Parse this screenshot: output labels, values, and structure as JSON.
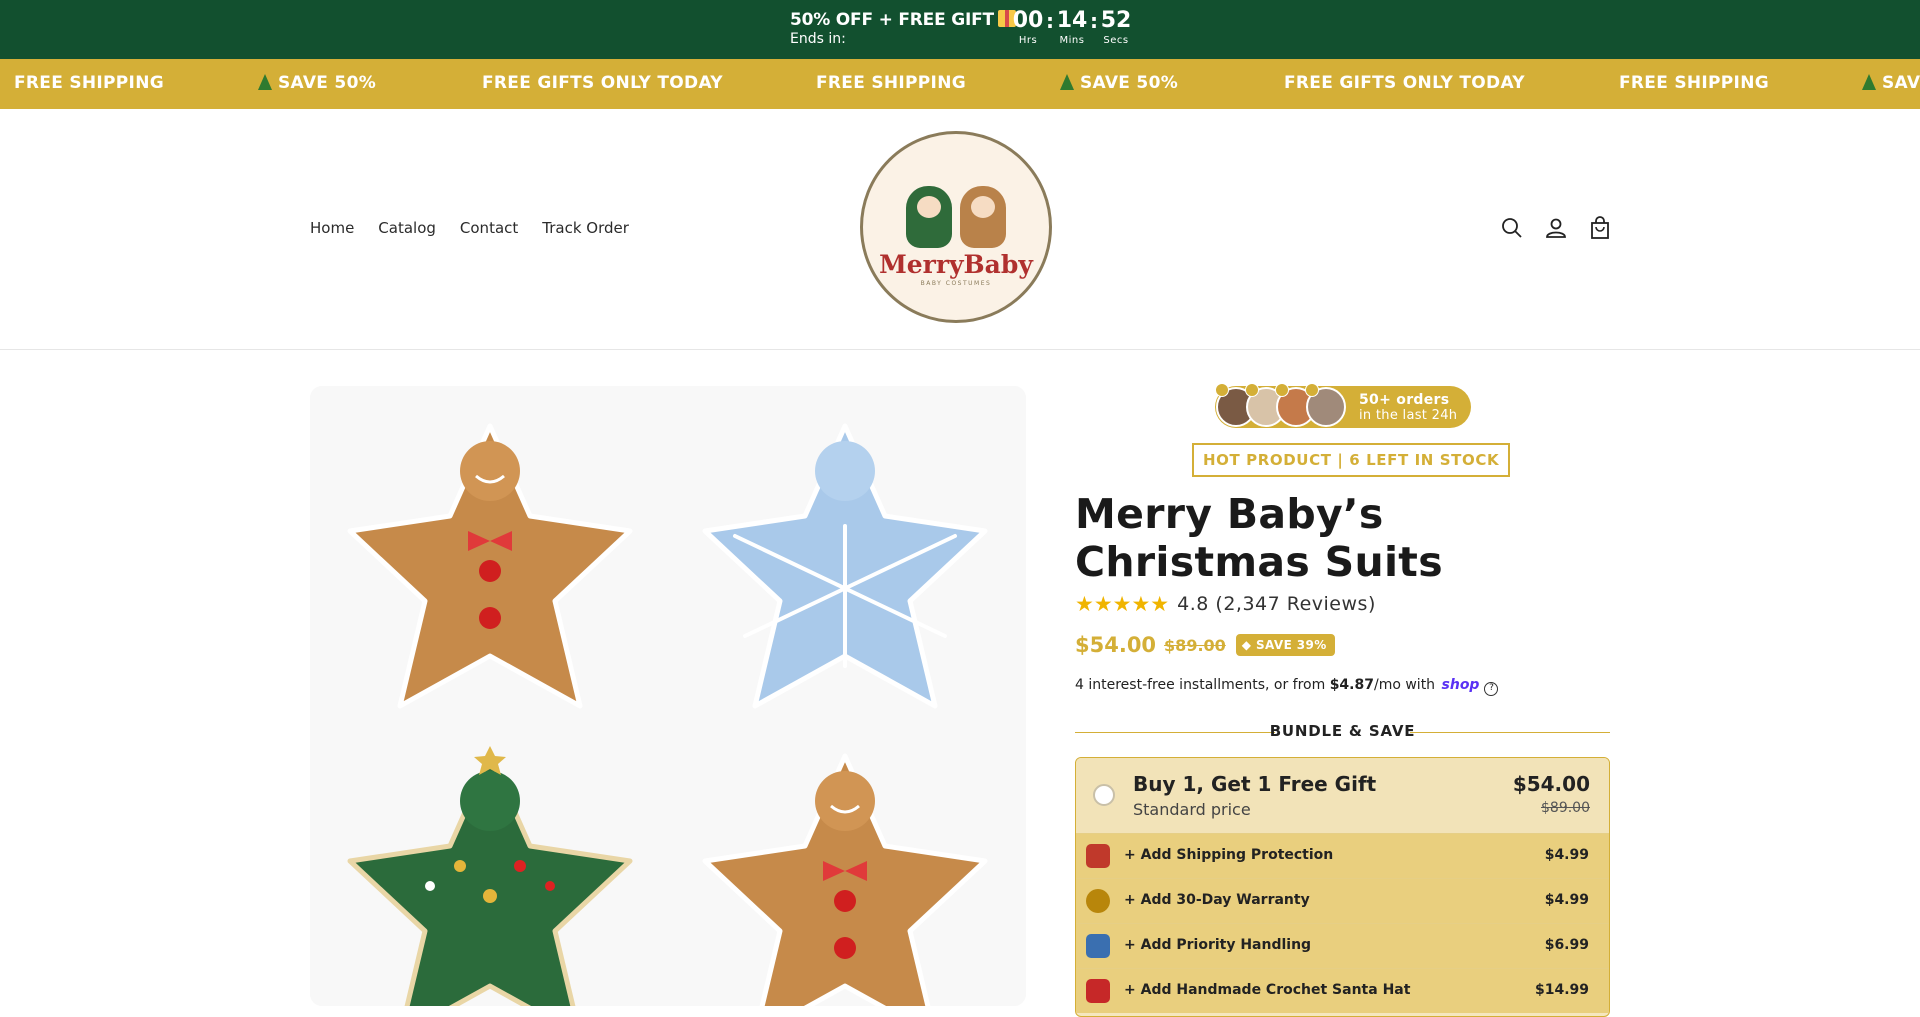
{
  "promo": {
    "title": "50% OFF + FREE GIFT",
    "ends_label": "Ends in:",
    "timer": [
      {
        "value": "00",
        "label": "Hrs"
      },
      {
        "value": "14",
        "label": "Mins"
      },
      {
        "value": "52",
        "label": "Secs"
      }
    ]
  },
  "marquee": [
    "FREE SHIPPING",
    "SAVE 50%",
    "FREE GIFTS ONLY TODAY",
    "FREE SHIPPING",
    "SAVE 50%",
    "FREE GIFTS ONLY TODAY",
    "FREE SHIPPING",
    "SAV"
  ],
  "nav": [
    "Home",
    "Catalog",
    "Contact",
    "Track Order"
  ],
  "logo": {
    "name": "MerryBaby",
    "sub": "BABY COSTUMES"
  },
  "header_icons": [
    "search-icon",
    "account-icon",
    "cart-icon"
  ],
  "social_proof": {
    "line1": "50+ orders",
    "line2": "in the last 24h"
  },
  "hot_badge": "HOT PRODUCT | 6 LEFT IN STOCK",
  "product": {
    "title": "Merry Baby’s Christmas Suits",
    "rating": "4.8",
    "reviews": "(2,347 Reviews)",
    "price": "$54.00",
    "compare_price": "$89.00",
    "save_badge": "SAVE 39%"
  },
  "installments": {
    "prefix": "4 interest-free installments, or from ",
    "amount": "$4.87",
    "suffix": "/mo with ",
    "brand": "shop"
  },
  "bundle": {
    "heading": "BUNDLE & SAVE",
    "option": {
      "title": "Buy 1, Get 1 Free Gift",
      "subtitle": "Standard price",
      "price": "$54.00",
      "compare": "$89.00"
    },
    "addons": [
      {
        "label": "+ Add Shipping Protection",
        "price": "$4.99",
        "icon": "package-shield-icon"
      },
      {
        "label": "+ Add 30-Day Warranty",
        "price": "$4.99",
        "icon": "warranty-badge-icon"
      },
      {
        "label": "+ Add Priority Handling",
        "price": "$6.99",
        "icon": "delivery-truck-icon"
      },
      {
        "label": "+ Add Handmade Crochet Santa Hat",
        "price": "$14.99",
        "icon": "santa-hat-icon"
      }
    ]
  },
  "colors": {
    "promo_bg": "#12502f",
    "marquee_bg": "#d4af37",
    "accent_gold": "#d4af37",
    "shop_purple": "#5a31f4"
  }
}
